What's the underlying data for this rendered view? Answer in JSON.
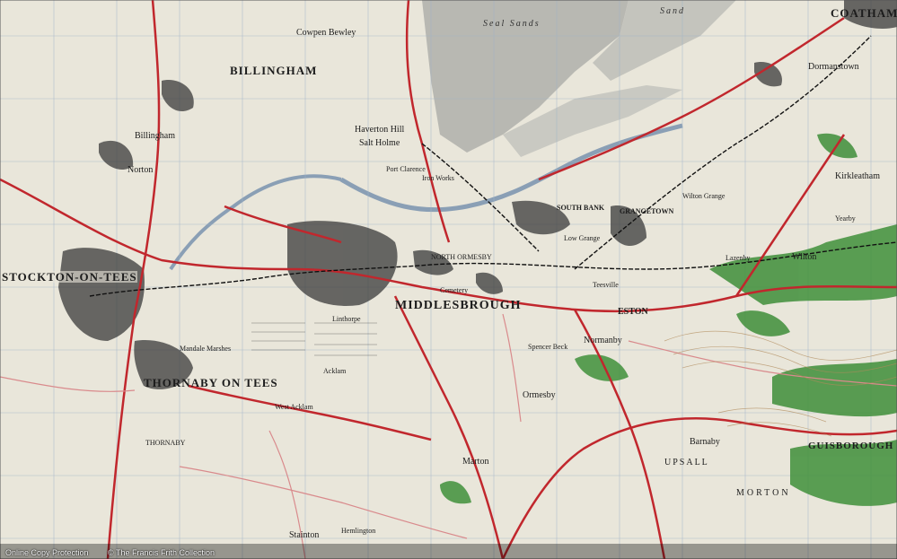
{
  "labels": {
    "seal_sands": "Seal Sands",
    "sand": "Sand",
    "coatham": "COATHAM",
    "cowpen_bewley": "Cowpen Bewley",
    "billingham": "BILLINGHAM",
    "billingham_small": "Billingham",
    "haverton_hill": "Haverton Hill",
    "salt_holme": "Salt Holme",
    "port_clarence": "Port Clarence",
    "iron_works": "Iron Works",
    "norton": "Norton",
    "stockton": "STOCKTON-ON-TEES",
    "thornaby": "THORNABY ON TEES",
    "thornaby_lower": "THORNABY",
    "north_ormesby": "NORTH ORMESBY",
    "middlesbrough": "MIDDLESBROUGH",
    "cemetery": "Cemetery",
    "south_bank": "SOUTH BANK",
    "grangetown": "GRANGETOWN",
    "eston": "ESTON",
    "normanby": "Normanby",
    "ormesby": "Ormesby",
    "marton": "Marton",
    "upsall": "UPSALL",
    "morton": "MORTON",
    "guisborough": "GUISBOROUGH",
    "stainton": "Stainton",
    "hemlington": "Hemlington",
    "lazenby": "Lazenby",
    "wilton": "Wilton",
    "kirkleatham": "Kirkleatham",
    "dormanstown": "Dormanstown",
    "barnaby": "Barnaby",
    "linthorpe": "Linthorpe",
    "low_grange": "Low Grange",
    "teesville": "Teesville",
    "west_acklam": "West Acklam",
    "mandale": "Mandale Marshes",
    "acklam": "Acklam",
    "spencer_beck": "Spencer Beck",
    "wilton_grange": "Wilton Grange",
    "yearby": "Yearby"
  },
  "footer": {
    "left": "Online Copy Protection",
    "right": "© The Francis Frith Collection"
  },
  "colors": {
    "paper": "#e9e6da",
    "sea": "#b8b8b2",
    "road_red": "#c1272d",
    "urban": "#3a3a3a",
    "woodland": "#3f8f3a",
    "grid": "#9fb3c8"
  }
}
